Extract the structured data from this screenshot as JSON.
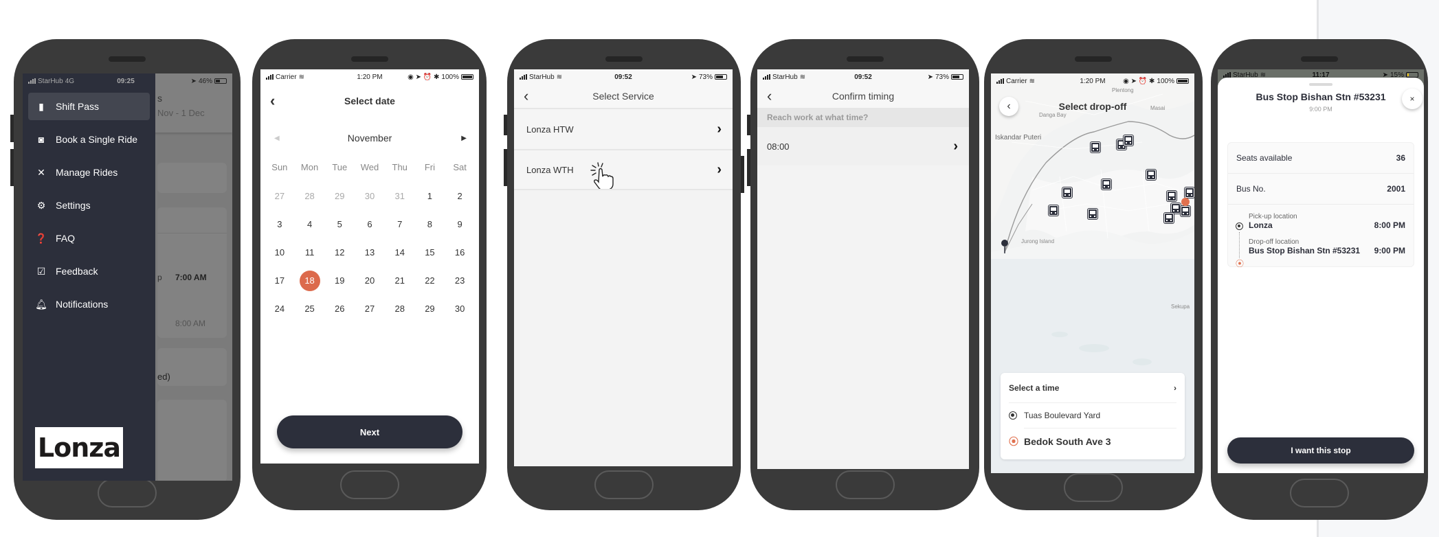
{
  "colors": {
    "accent": "#dc6a4c",
    "primary_dark": "#2c2f3b",
    "phone_frame": "#3a3a3a"
  },
  "phone1": {
    "status": {
      "carrier": "StarHub",
      "network": "4G",
      "time": "09:25",
      "battery": "46%"
    },
    "background": {
      "title_fragment": "s",
      "date_range_fragment": "Nov - 1 Dec",
      "time_1": "7:00 AM",
      "time_1_prefix": "p",
      "time_2": "8:00 AM",
      "status_fragment": "ed)"
    },
    "menu": [
      {
        "label": "Shift Pass",
        "icon": "ticket-icon",
        "active": true
      },
      {
        "label": "Book a Single Ride",
        "icon": "ticket-clock-icon",
        "active": false
      },
      {
        "label": "Manage Rides",
        "icon": "tools-icon",
        "active": false
      },
      {
        "label": "Settings",
        "icon": "gear-icon",
        "active": false
      },
      {
        "label": "FAQ",
        "icon": "question-bubble-icon",
        "active": false
      },
      {
        "label": "Feedback",
        "icon": "feedback-icon",
        "active": false
      },
      {
        "label": "Notifications",
        "icon": "bell-icon",
        "active": false
      }
    ],
    "logo_text": "Lonza"
  },
  "phone2": {
    "status": {
      "carrier": "Carrier",
      "time": "1:20 PM",
      "battery": "100%"
    },
    "title": "Select date",
    "month": "November",
    "weekdays": [
      "Sun",
      "Mon",
      "Tue",
      "Wed",
      "Thu",
      "Fri",
      "Sat"
    ],
    "weeks": [
      [
        "27",
        "28",
        "29",
        "30",
        "31",
        "1",
        "2"
      ],
      [
        "3",
        "4",
        "5",
        "6",
        "7",
        "8",
        "9"
      ],
      [
        "10",
        "11",
        "12",
        "13",
        "14",
        "15",
        "16"
      ],
      [
        "17",
        "18",
        "19",
        "20",
        "21",
        "22",
        "23"
      ],
      [
        "24",
        "25",
        "26",
        "27",
        "28",
        "29",
        "30"
      ]
    ],
    "previous_month_days_in_first_week": 5,
    "selected_day": "18",
    "next_label": "Next"
  },
  "phone3": {
    "status": {
      "carrier": "StarHub",
      "time": "09:52",
      "battery": "73%"
    },
    "title": "Select Service",
    "services": [
      "Lonza HTW",
      "Lonza WTH"
    ]
  },
  "phone4": {
    "status": {
      "carrier": "StarHub",
      "time": "09:52",
      "battery": "73%"
    },
    "title": "Confirm timing",
    "section_label": "Reach work at what time?",
    "time_value": "08:00"
  },
  "phone5": {
    "status": {
      "carrier": "Carrier",
      "time": "1:20 PM",
      "battery": "100%"
    },
    "title": "Select drop-off",
    "map_labels": [
      "Plentong",
      "Danga Bay",
      "Masai",
      "Iskandar Puteri",
      "Jurong Island",
      "Sekupa"
    ],
    "select_time_label": "Select a time",
    "pickup": "Tuas Boulevard Yard",
    "dropoff": "Bedok South Ave 3"
  },
  "phone6": {
    "status": {
      "carrier": "StarHub",
      "time": "11:17",
      "battery": "15%"
    },
    "stop_title": "Bus Stop Bishan Stn #53231",
    "stop_time": "9:00 PM",
    "close_label": "×",
    "rows": [
      {
        "label": "Seats available",
        "value": "36"
      },
      {
        "label": "Bus No.",
        "value": "2001"
      }
    ],
    "pickup_label": "Pick-up location",
    "pickup_name": "Lonza",
    "pickup_time": "8:00 PM",
    "dropoff_label": "Drop-off location",
    "dropoff_name": "Bus Stop Bishan Stn #53231",
    "dropoff_time": "9:00 PM",
    "cta_label": "I want this stop"
  }
}
